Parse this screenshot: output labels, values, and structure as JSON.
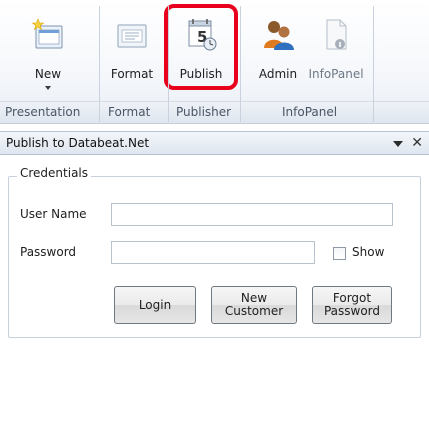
{
  "ribbon": {
    "buttons": [
      {
        "label": "New",
        "icon": "new-presentation-icon",
        "dropdown": true
      },
      {
        "label": "Format",
        "icon": "format-icon"
      },
      {
        "label": "Publish",
        "icon": "publish-calendar-icon",
        "icon_text": "5"
      },
      {
        "label": "Admin",
        "icon": "admin-users-icon"
      },
      {
        "label": "InfoPanel",
        "icon": "info-panel-icon",
        "disabled": true
      }
    ],
    "groups": [
      "Presentation",
      "Format",
      "Publisher",
      "InfoPanel"
    ],
    "highlight_color": "#e8001c"
  },
  "pane": {
    "title": "Publish to Databeat.Net",
    "close_glyph": "✕",
    "credentials": {
      "legend": "Credentials",
      "username_label": "User Name",
      "username_value": "",
      "password_label": "Password",
      "password_value": "",
      "show_label": "Show",
      "show_checked": false
    },
    "buttons": {
      "login": "Login",
      "new_customer": [
        "New",
        "Customer"
      ],
      "forgot_password": [
        "Forgot",
        "Password"
      ]
    }
  }
}
